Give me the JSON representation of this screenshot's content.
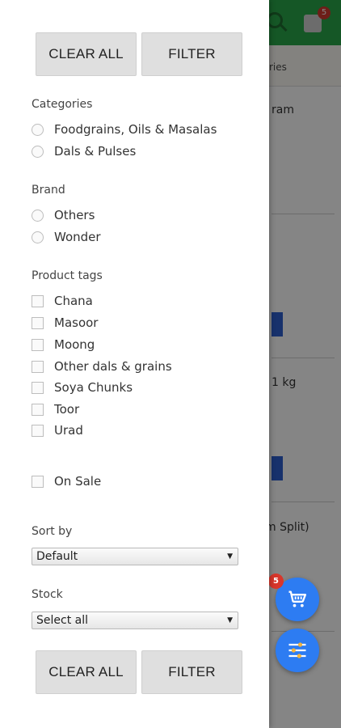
{
  "background": {
    "cart_badge": "5",
    "tab_fragment": "ries",
    "text_fragments": [
      "ram",
      "1 kg",
      "m Split)"
    ]
  },
  "drawer": {
    "clear_all_label": "CLEAR ALL",
    "filter_label": "FILTER",
    "categories": {
      "title": "Categories",
      "options": [
        "Foodgrains, Oils & Masalas",
        "Dals & Pulses"
      ]
    },
    "brand": {
      "title": "Brand",
      "options": [
        "Others",
        "Wonder"
      ]
    },
    "product_tags": {
      "title": "Product tags",
      "options": [
        "Chana",
        "Masoor",
        "Moong",
        "Other dals & grains",
        "Soya Chunks",
        "Toor",
        "Urad"
      ]
    },
    "on_sale_label": "On Sale",
    "sort_by": {
      "title": "Sort by",
      "selected": "Default"
    },
    "stock": {
      "title": "Stock",
      "selected": "Select all"
    }
  },
  "fab": {
    "cart_count": "5"
  },
  "icons": {
    "cart": "cart-icon",
    "filter": "sliders-icon",
    "search": "search-icon",
    "bag": "shopping-bag-icon"
  },
  "colors": {
    "header_green": "#2aa74a",
    "fab_blue": "#2d7cf2",
    "badge_red": "#d8362b"
  }
}
